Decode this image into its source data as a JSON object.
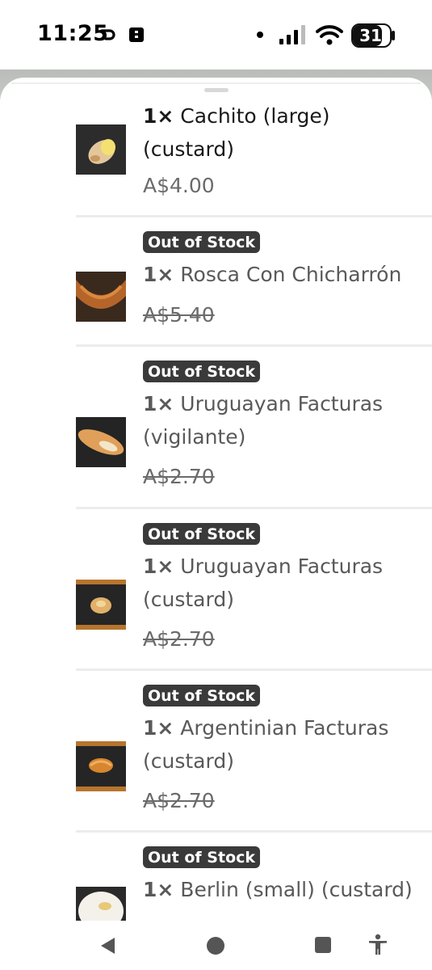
{
  "status_bar": {
    "time": "11:25",
    "notification_icons": [
      "link-icon",
      "sim-icon"
    ],
    "battery": "31",
    "indicators": [
      "dot-icon",
      "signal-icon",
      "wifi-icon",
      "battery-icon"
    ]
  },
  "items": [
    {
      "qty": "1×",
      "name": "Cachito (large)",
      "name2": "(custard)",
      "price": "A$4.00",
      "out_of_stock": false
    },
    {
      "badge": "Out of Stock",
      "qty": "1×",
      "name": "Rosca Con Chicharrón",
      "name2": "",
      "price": "A$5.40",
      "out_of_stock": true
    },
    {
      "badge": "Out of Stock",
      "qty": "1×",
      "name": "Uruguayan Facturas",
      "name2": "(vigilante)",
      "price": "A$2.70",
      "out_of_stock": true
    },
    {
      "badge": "Out of Stock",
      "qty": "1×",
      "name": "Uruguayan Facturas",
      "name2": "(custard)",
      "price": "A$2.70",
      "out_of_stock": true
    },
    {
      "badge": "Out of Stock",
      "qty": "1×",
      "name": "Argentinian Facturas",
      "name2": "(custard)",
      "price": "A$2.70",
      "out_of_stock": true
    },
    {
      "badge": "Out of Stock",
      "qty": "1×",
      "name": "Berlin (small) (custard)",
      "name2": "",
      "price": "",
      "out_of_stock": true
    }
  ],
  "nav": {
    "buttons": [
      "back-icon",
      "home-icon",
      "recents-icon",
      "accessibility-icon"
    ]
  }
}
